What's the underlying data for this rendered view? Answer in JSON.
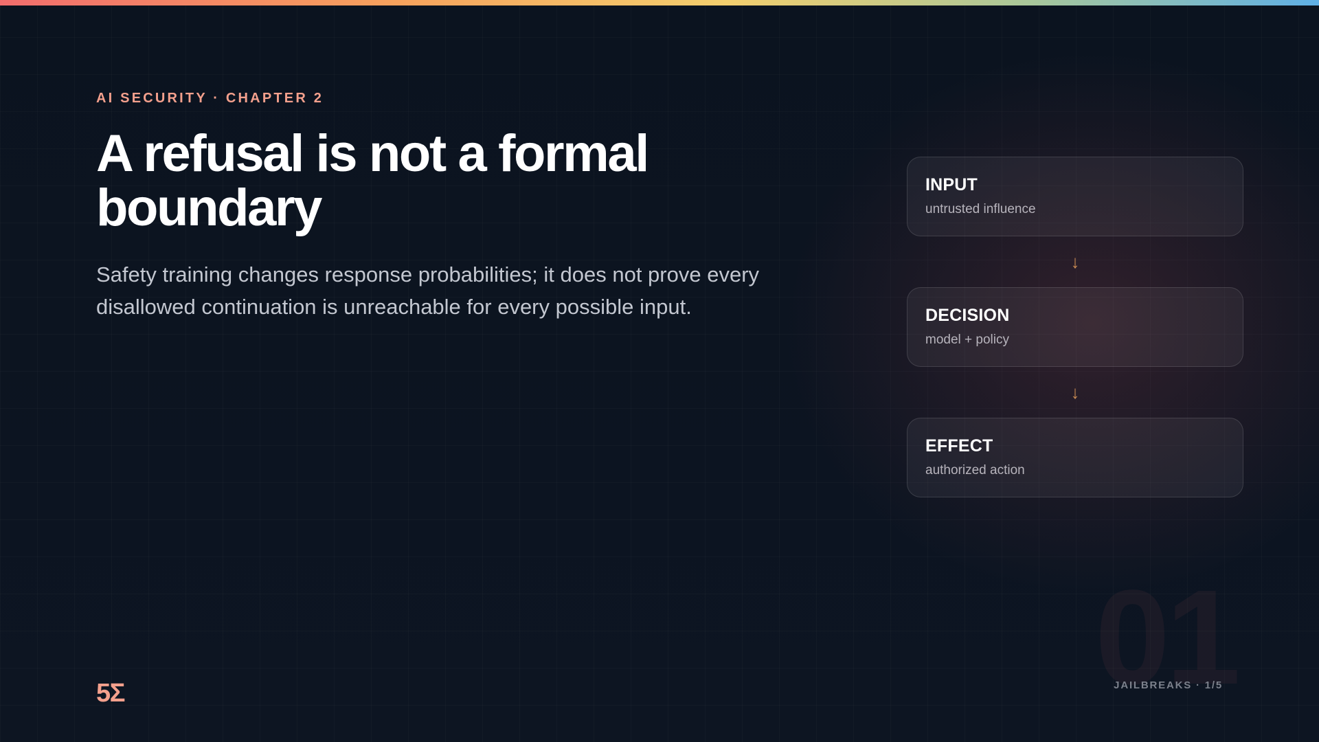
{
  "slide": {
    "eyebrow": "AI SECURITY · CHAPTER 2",
    "title": "A refusal is not a formal boundary",
    "subtitle": "Safety training changes response probabilities; it does not prove every disallowed continuation is unreachable for every possible input."
  },
  "flow": {
    "steps": [
      {
        "title": "INPUT",
        "subtitle": "untrusted influence"
      },
      {
        "title": "DECISION",
        "subtitle": "model + policy"
      },
      {
        "title": "EFFECT",
        "subtitle": "authorized action"
      }
    ],
    "arrow_glyph": "↓"
  },
  "footer": {
    "slide_number": "01",
    "section_label": "JAILBREAKS · 1/5",
    "logo_text": "5Σ"
  },
  "colors": {
    "accent": "#f4a08d",
    "arrow": "#c98a52",
    "background": "#0b1320",
    "top_bar_gradient": [
      "#f26d6d",
      "#f7a25d",
      "#f4cf6e",
      "#a9c79a",
      "#5fb0e6"
    ]
  }
}
